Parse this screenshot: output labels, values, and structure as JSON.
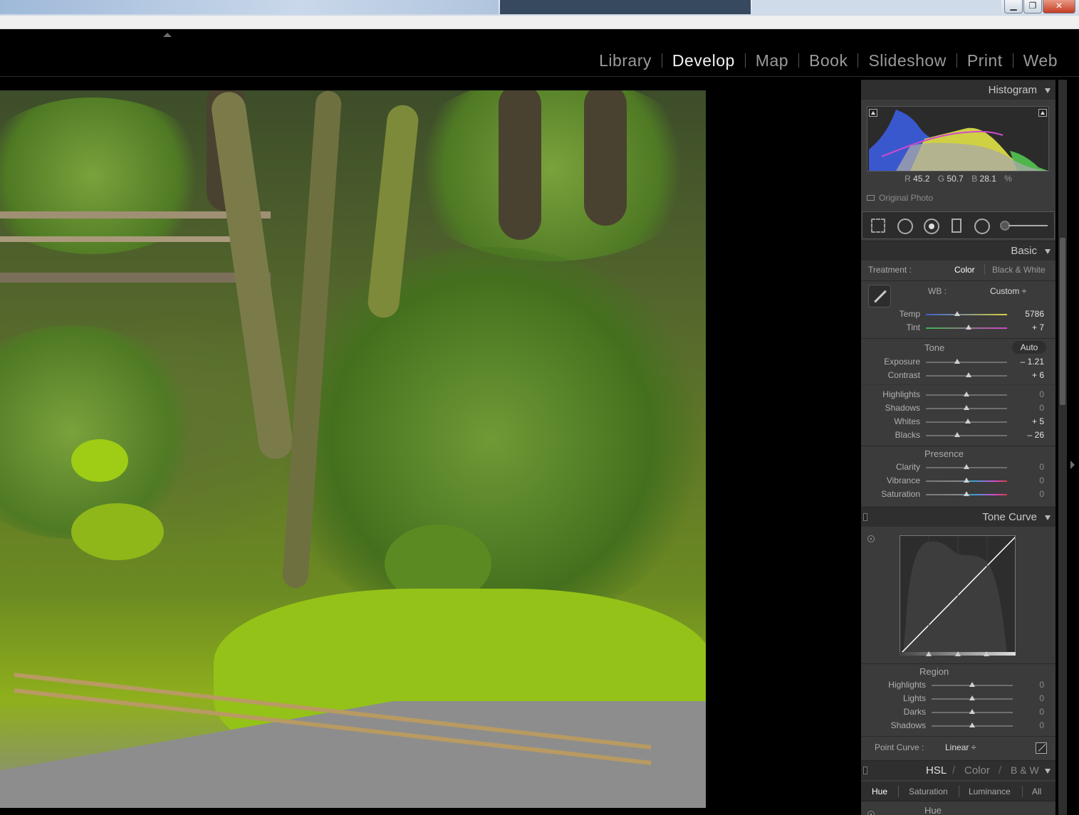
{
  "window": {
    "buttons": {
      "minimize": "▁",
      "restore": "❐",
      "close": "✕"
    }
  },
  "modules": [
    "Library",
    "Develop",
    "Map",
    "Book",
    "Slideshow",
    "Print",
    "Web"
  ],
  "active_module": "Develop",
  "histogram": {
    "title": "Histogram",
    "r_label": "R",
    "r_value": "45.2",
    "g_label": "G",
    "g_value": "50.7",
    "b_label": "B",
    "b_value": "28.1",
    "unit": "%",
    "original_photo": "Original Photo"
  },
  "tools": [
    "crop-overlay",
    "spot-removal",
    "red-eye-correction",
    "graduated-filter",
    "radial-filter",
    "adjustment-brush"
  ],
  "basic": {
    "title": "Basic",
    "treatment_label": "Treatment :",
    "treatment_color": "Color",
    "treatment_bw": "Black & White",
    "wb_label": "WB :",
    "wb_value": "Custom ÷",
    "temp": {
      "label": "Temp",
      "value": "5786",
      "position": 0.39
    },
    "tint": {
      "label": "Tint",
      "value": "+ 7",
      "position": 0.53
    },
    "tone_title": "Tone",
    "auto": "Auto",
    "exposure": {
      "label": "Exposure",
      "value": "– 1.21",
      "position": 0.39
    },
    "contrast": {
      "label": "Contrast",
      "value": "+ 6",
      "position": 0.53
    },
    "highlights": {
      "label": "Highlights",
      "value": "0",
      "position": 0.5
    },
    "shadows": {
      "label": "Shadows",
      "value": "0",
      "position": 0.5
    },
    "whites": {
      "label": "Whites",
      "value": "+ 5",
      "position": 0.52
    },
    "blacks": {
      "label": "Blacks",
      "value": "– 26",
      "position": 0.39
    },
    "presence_title": "Presence",
    "clarity": {
      "label": "Clarity",
      "value": "0",
      "position": 0.5
    },
    "vibrance": {
      "label": "Vibrance",
      "value": "0",
      "position": 0.5
    },
    "saturation": {
      "label": "Saturation",
      "value": "0",
      "position": 0.5
    }
  },
  "tone_curve": {
    "title": "Tone Curve",
    "region_title": "Region",
    "highlights": {
      "label": "Highlights",
      "value": "0",
      "position": 0.5
    },
    "lights": {
      "label": "Lights",
      "value": "0",
      "position": 0.5
    },
    "darks": {
      "label": "Darks",
      "value": "0",
      "position": 0.5
    },
    "shadows": {
      "label": "Shadows",
      "value": "0",
      "position": 0.5
    },
    "point_curve_label": "Point Curve :",
    "point_curve_value": "Linear ÷"
  },
  "hsl": {
    "title_hsl": "HSL",
    "slash": "/",
    "title_color": "Color",
    "title_bw": "B & W",
    "tabs": [
      "Hue",
      "Saturation",
      "Luminance",
      "All"
    ],
    "active_tab": "Hue",
    "sub_title": "Hue"
  },
  "colors": {
    "panel_bg": "#3b3b3b",
    "header_bg": "#2f2f2f",
    "active_module": "#f2f2f2",
    "inactive_module": "#9a9a9a"
  }
}
